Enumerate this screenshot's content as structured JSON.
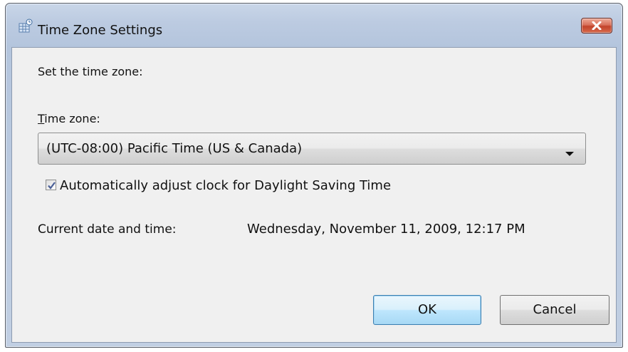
{
  "window": {
    "title": "Time Zone Settings",
    "icon": "clock-globe-icon",
    "close_icon": "close-x-icon"
  },
  "dialog": {
    "instruction": "Set the time zone:",
    "timezone_label": "Time zone:",
    "timezone_selected": "(UTC-08:00) Pacific Time (US & Canada)",
    "dst_checkbox_label": "Automatically adjust clock for Daylight Saving Time",
    "dst_checked": true,
    "current_label": "Current date and time:",
    "current_value": "Wednesday, November 11, 2009, 12:17 PM"
  },
  "buttons": {
    "ok": "OK",
    "cancel": "Cancel"
  },
  "colors": {
    "frame": "#bccbe1",
    "client_bg": "#f0f0f0",
    "close_button": "#c2432a",
    "default_button_border": "#3c7fb1"
  }
}
